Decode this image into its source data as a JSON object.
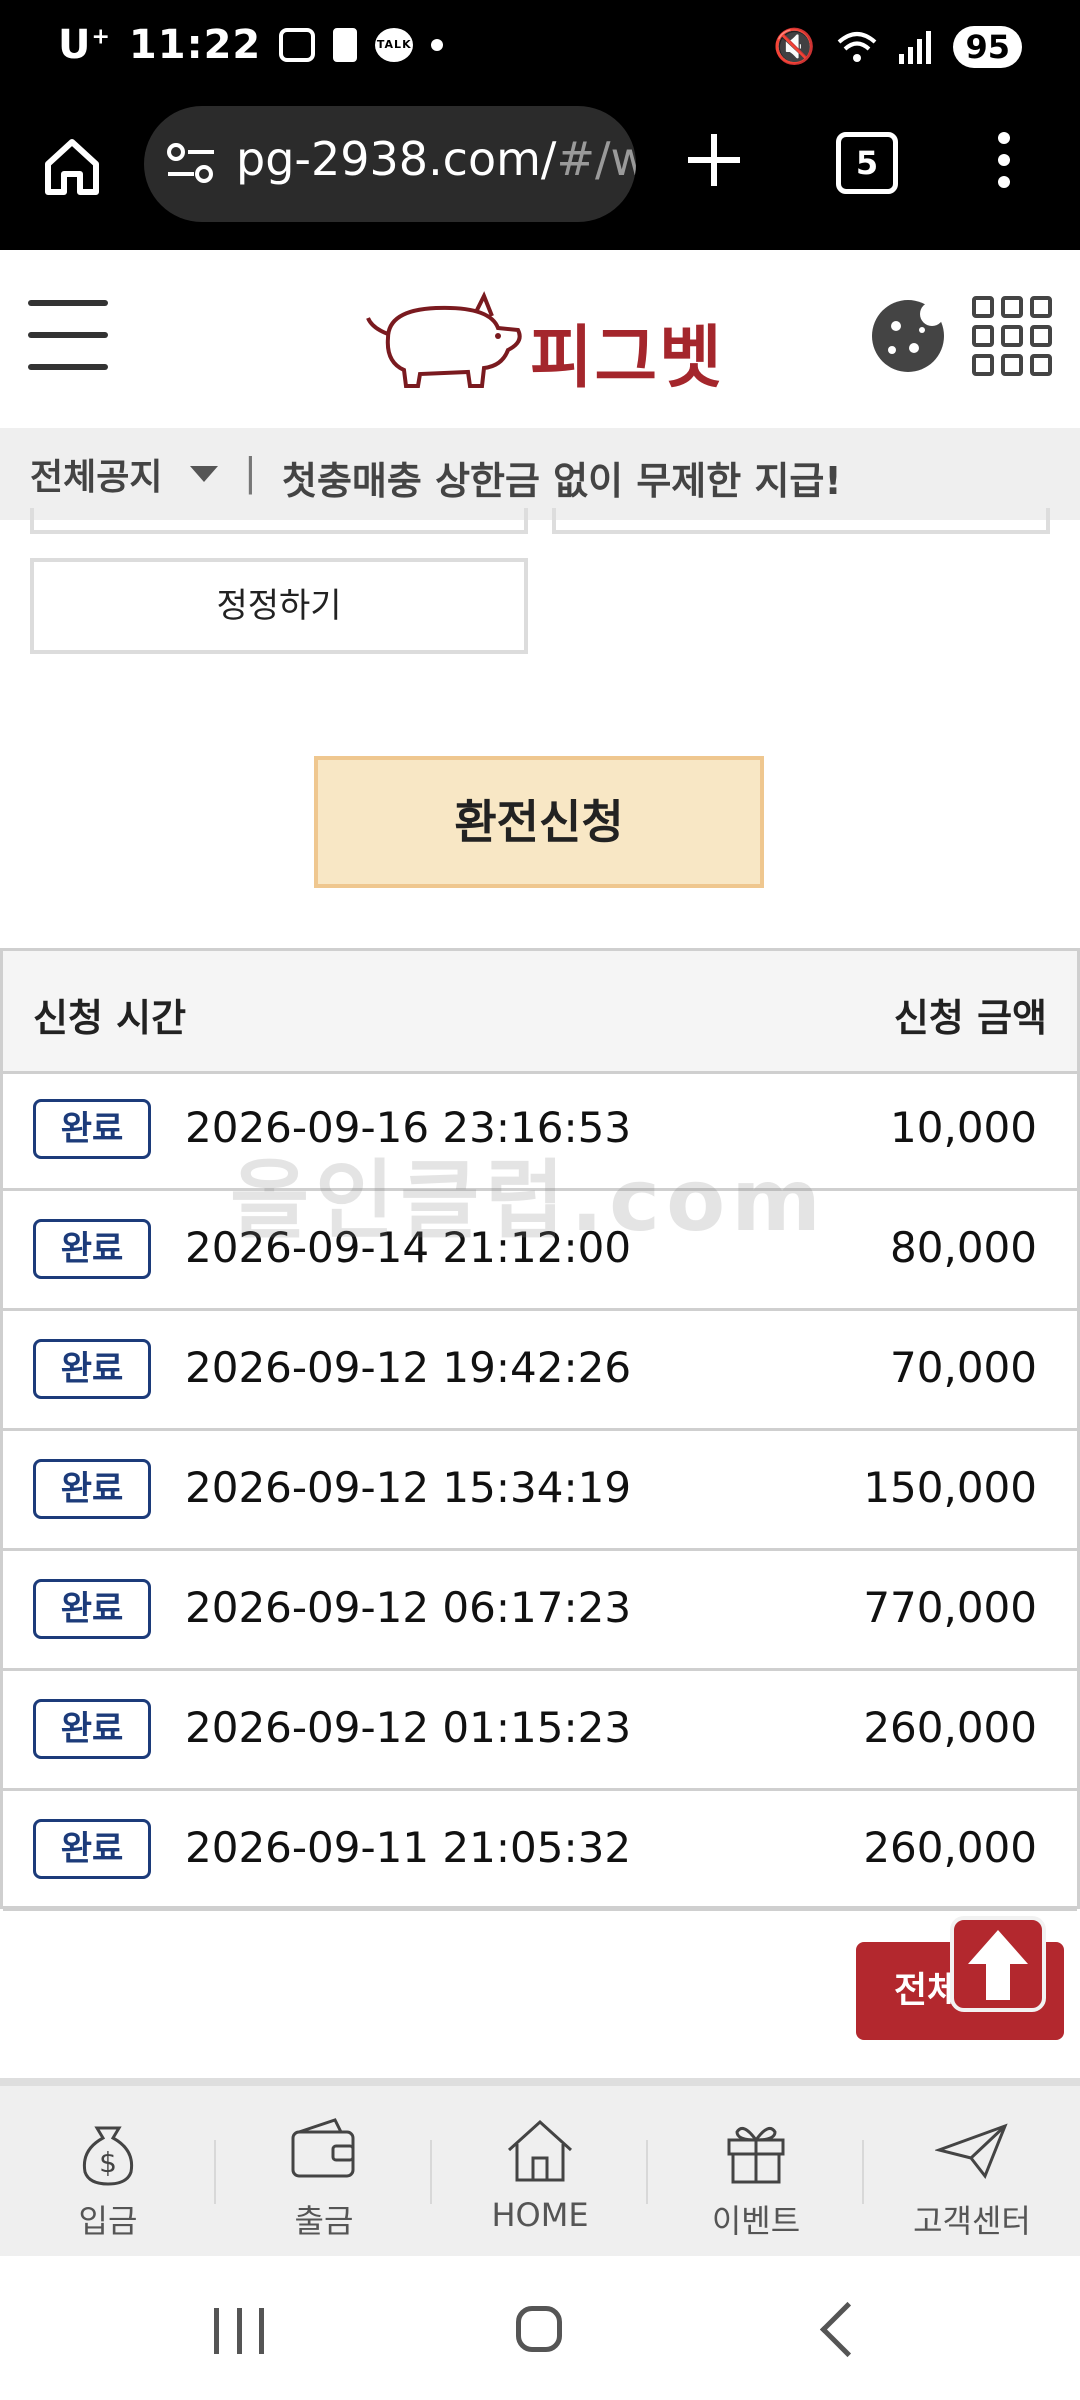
{
  "status_bar": {
    "carrier": "U",
    "carrier_sup": "+",
    "time": "11:22",
    "talk_badge": "TALK",
    "battery": "95"
  },
  "browser": {
    "url_main": "pg-2938.com/",
    "url_dim": "#/w",
    "tab_count": "5"
  },
  "header": {
    "logo_text": "피그벳"
  },
  "notice": {
    "label": "전체공지",
    "separator": "|",
    "text": "첫충매충 상한금 없이 무제한 지급!"
  },
  "form": {
    "correct_label": "정정하기",
    "exchange_label": "환전신청"
  },
  "history": {
    "col_time": "신청 시간",
    "col_amount": "신청 금액",
    "rows": [
      {
        "status": "완료",
        "time": "2026-09-16 23:16:53",
        "amount": "10,000"
      },
      {
        "status": "완료",
        "time": "2026-09-14 21:12:00",
        "amount": "80,000"
      },
      {
        "status": "완료",
        "time": "2026-09-12 19:42:26",
        "amount": "70,000"
      },
      {
        "status": "완료",
        "time": "2026-09-12 15:34:19",
        "amount": "150,000"
      },
      {
        "status": "완료",
        "time": "2026-09-12 06:17:23",
        "amount": "770,000"
      },
      {
        "status": "완료",
        "time": "2026-09-12 01:15:23",
        "amount": "260,000"
      },
      {
        "status": "완료",
        "time": "2026-09-11 21:05:32",
        "amount": "260,000"
      }
    ]
  },
  "watermark": "올인클럽.com",
  "all_button": "전체",
  "bottom_nav": [
    {
      "label": "입금",
      "icon": "money-bag-icon"
    },
    {
      "label": "출금",
      "icon": "wallet-icon"
    },
    {
      "label": "HOME",
      "icon": "house-icon"
    },
    {
      "label": "이벤트",
      "icon": "gift-icon"
    },
    {
      "label": "고객센터",
      "icon": "paper-plane-icon"
    }
  ],
  "colors": {
    "brand_red": "#b3282e",
    "badge_blue": "#1c3b7a",
    "exchange_bg": "#f8e7c5"
  }
}
